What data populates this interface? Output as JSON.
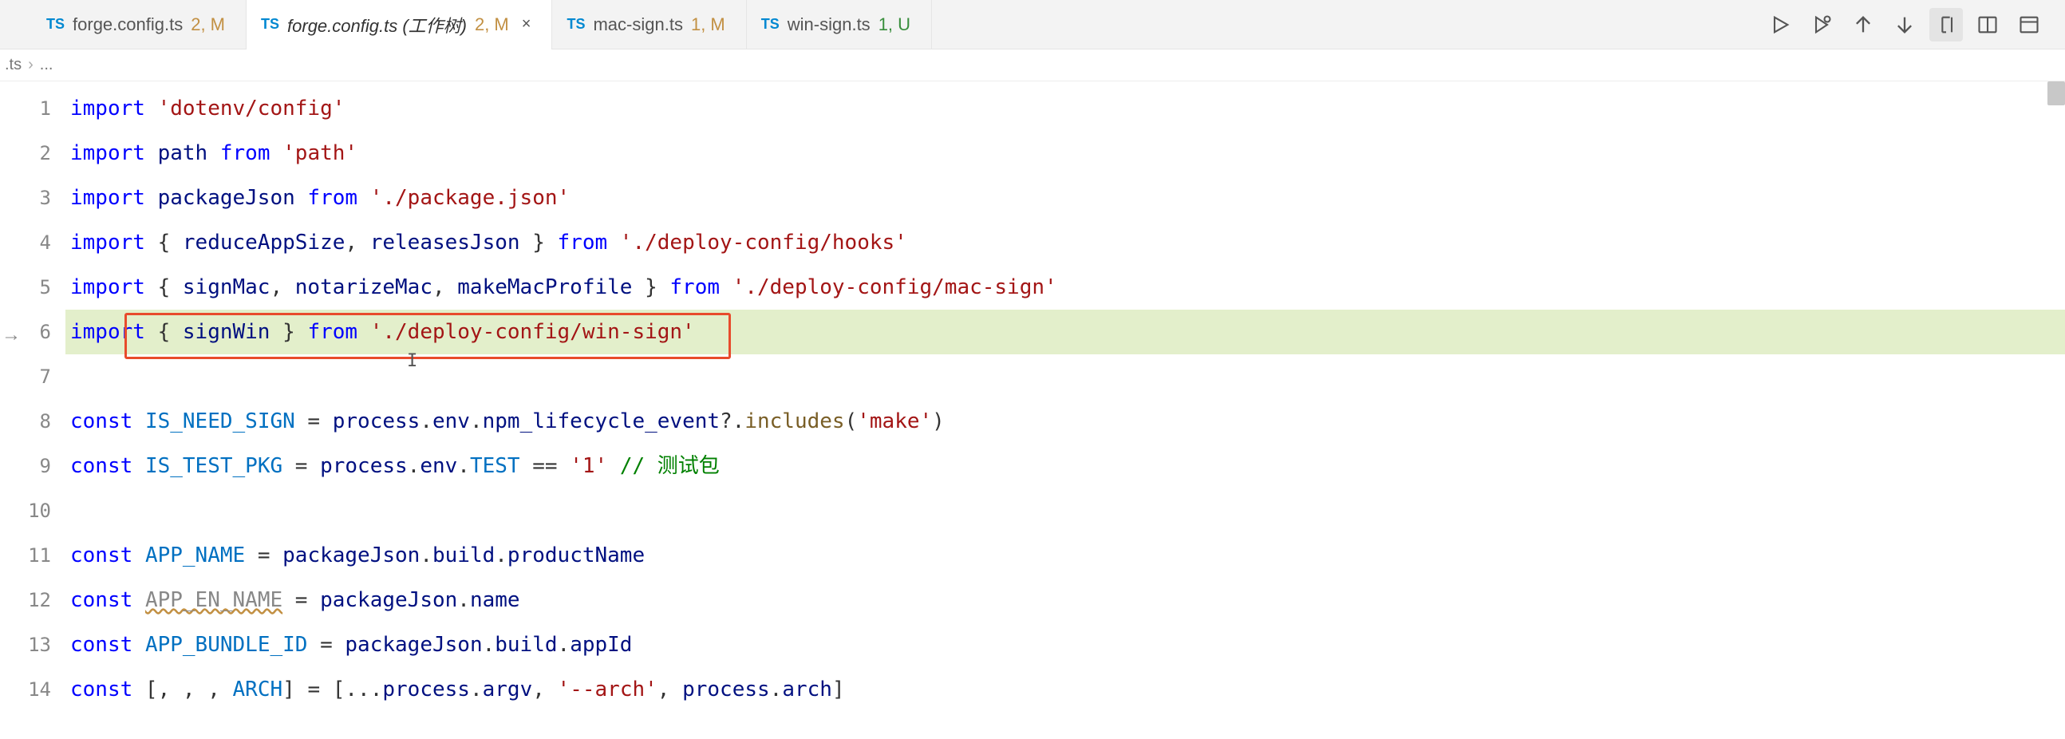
{
  "tabs": [
    {
      "icon": "TS",
      "filename": "forge.config.ts",
      "badge": "2, M",
      "badgeClass": "m",
      "active": false,
      "closable": false
    },
    {
      "icon": "TS",
      "filename": "forge.config.ts (工作树)",
      "badge": "2, M",
      "badgeClass": "m",
      "active": true,
      "closable": true
    },
    {
      "icon": "TS",
      "filename": "mac-sign.ts",
      "badge": "1, M",
      "badgeClass": "m",
      "active": false,
      "closable": false
    },
    {
      "icon": "TS",
      "filename": "win-sign.ts",
      "badge": "1, U",
      "badgeClass": "u",
      "active": false,
      "closable": false
    }
  ],
  "breadcrumb": {
    "segment0": ".ts",
    "segment1": "..."
  },
  "toolbar": {
    "run": "run",
    "debug": "debug",
    "up": "up",
    "down": "down",
    "whitespace": "whitespace",
    "split": "split",
    "more": "more"
  },
  "code": {
    "lines": [
      {
        "n": 1,
        "tokens": [
          {
            "cls": "kw",
            "t": "import"
          },
          {
            "cls": "plain",
            "t": " "
          },
          {
            "cls": "str",
            "t": "'dotenv/config'"
          }
        ]
      },
      {
        "n": 2,
        "tokens": [
          {
            "cls": "kw",
            "t": "import"
          },
          {
            "cls": "plain",
            "t": " "
          },
          {
            "cls": "ident",
            "t": "path"
          },
          {
            "cls": "plain",
            "t": " "
          },
          {
            "cls": "kw",
            "t": "from"
          },
          {
            "cls": "plain",
            "t": " "
          },
          {
            "cls": "str",
            "t": "'path'"
          }
        ]
      },
      {
        "n": 3,
        "tokens": [
          {
            "cls": "kw",
            "t": "import"
          },
          {
            "cls": "plain",
            "t": " "
          },
          {
            "cls": "ident",
            "t": "packageJson"
          },
          {
            "cls": "plain",
            "t": " "
          },
          {
            "cls": "kw",
            "t": "from"
          },
          {
            "cls": "plain",
            "t": " "
          },
          {
            "cls": "str",
            "t": "'./package.json'"
          }
        ]
      },
      {
        "n": 4,
        "tokens": [
          {
            "cls": "kw",
            "t": "import"
          },
          {
            "cls": "plain",
            "t": " { "
          },
          {
            "cls": "ident",
            "t": "reduceAppSize"
          },
          {
            "cls": "plain",
            "t": ", "
          },
          {
            "cls": "ident",
            "t": "releasesJson"
          },
          {
            "cls": "plain",
            "t": " } "
          },
          {
            "cls": "kw",
            "t": "from"
          },
          {
            "cls": "plain",
            "t": " "
          },
          {
            "cls": "str",
            "t": "'./deploy-config/hooks'"
          }
        ]
      },
      {
        "n": 5,
        "tokens": [
          {
            "cls": "kw",
            "t": "import"
          },
          {
            "cls": "plain",
            "t": " { "
          },
          {
            "cls": "ident",
            "t": "signMac"
          },
          {
            "cls": "plain",
            "t": ", "
          },
          {
            "cls": "ident",
            "t": "notarizeMac"
          },
          {
            "cls": "plain",
            "t": ", "
          },
          {
            "cls": "ident",
            "t": "makeMacProfile"
          },
          {
            "cls": "plain",
            "t": " } "
          },
          {
            "cls": "kw",
            "t": "from"
          },
          {
            "cls": "plain",
            "t": " "
          },
          {
            "cls": "str",
            "t": "'./deploy-config/mac-sign'"
          }
        ]
      },
      {
        "n": 6,
        "hl": true,
        "tokens": [
          {
            "cls": "kw",
            "t": "import"
          },
          {
            "cls": "plain",
            "t": " { "
          },
          {
            "cls": "ident",
            "t": "signWin"
          },
          {
            "cls": "plain",
            "t": " } "
          },
          {
            "cls": "kw",
            "t": "from"
          },
          {
            "cls": "plain",
            "t": " "
          },
          {
            "cls": "str",
            "t": "'./deploy-config/win-sign'"
          }
        ]
      },
      {
        "n": 7,
        "tokens": []
      },
      {
        "n": 8,
        "tokens": [
          {
            "cls": "kw",
            "t": "const"
          },
          {
            "cls": "plain",
            "t": " "
          },
          {
            "cls": "const",
            "t": "IS_NEED_SIGN"
          },
          {
            "cls": "plain",
            "t": " = "
          },
          {
            "cls": "ident",
            "t": "process"
          },
          {
            "cls": "plain",
            "t": "."
          },
          {
            "cls": "ident",
            "t": "env"
          },
          {
            "cls": "plain",
            "t": "."
          },
          {
            "cls": "ident",
            "t": "npm_lifecycle_event"
          },
          {
            "cls": "plain",
            "t": "?."
          },
          {
            "cls": "fn",
            "t": "includes"
          },
          {
            "cls": "plain",
            "t": "("
          },
          {
            "cls": "str",
            "t": "'make'"
          },
          {
            "cls": "plain",
            "t": ")"
          }
        ]
      },
      {
        "n": 9,
        "tokens": [
          {
            "cls": "kw",
            "t": "const"
          },
          {
            "cls": "plain",
            "t": " "
          },
          {
            "cls": "const",
            "t": "IS_TEST_PKG"
          },
          {
            "cls": "plain",
            "t": " = "
          },
          {
            "cls": "ident",
            "t": "process"
          },
          {
            "cls": "plain",
            "t": "."
          },
          {
            "cls": "ident",
            "t": "env"
          },
          {
            "cls": "plain",
            "t": "."
          },
          {
            "cls": "const",
            "t": "TEST"
          },
          {
            "cls": "plain",
            "t": " == "
          },
          {
            "cls": "str",
            "t": "'1'"
          },
          {
            "cls": "plain",
            "t": " "
          },
          {
            "cls": "comment",
            "t": "// 测试包"
          }
        ]
      },
      {
        "n": 10,
        "tokens": []
      },
      {
        "n": 11,
        "tokens": [
          {
            "cls": "kw",
            "t": "const"
          },
          {
            "cls": "plain",
            "t": " "
          },
          {
            "cls": "const",
            "t": "APP_NAME"
          },
          {
            "cls": "plain",
            "t": " = "
          },
          {
            "cls": "ident",
            "t": "packageJson"
          },
          {
            "cls": "plain",
            "t": "."
          },
          {
            "cls": "ident",
            "t": "build"
          },
          {
            "cls": "plain",
            "t": "."
          },
          {
            "cls": "ident",
            "t": "productName"
          }
        ]
      },
      {
        "n": 12,
        "tokens": [
          {
            "cls": "kw",
            "t": "const"
          },
          {
            "cls": "plain",
            "t": " "
          },
          {
            "cls": "squiggly",
            "t": "APP_EN_NAME"
          },
          {
            "cls": "plain",
            "t": " = "
          },
          {
            "cls": "ident",
            "t": "packageJson"
          },
          {
            "cls": "plain",
            "t": "."
          },
          {
            "cls": "ident",
            "t": "name"
          }
        ]
      },
      {
        "n": 13,
        "tokens": [
          {
            "cls": "kw",
            "t": "const"
          },
          {
            "cls": "plain",
            "t": " "
          },
          {
            "cls": "const",
            "t": "APP_BUNDLE_ID"
          },
          {
            "cls": "plain",
            "t": " = "
          },
          {
            "cls": "ident",
            "t": "packageJson"
          },
          {
            "cls": "plain",
            "t": "."
          },
          {
            "cls": "ident",
            "t": "build"
          },
          {
            "cls": "plain",
            "t": "."
          },
          {
            "cls": "ident",
            "t": "appId"
          }
        ]
      },
      {
        "n": 14,
        "tokens": [
          {
            "cls": "kw",
            "t": "const"
          },
          {
            "cls": "plain",
            "t": " [, , , "
          },
          {
            "cls": "const",
            "t": "ARCH"
          },
          {
            "cls": "plain",
            "t": "] = [..."
          },
          {
            "cls": "ident",
            "t": "process"
          },
          {
            "cls": "plain",
            "t": "."
          },
          {
            "cls": "ident",
            "t": "argv"
          },
          {
            "cls": "plain",
            "t": ", "
          },
          {
            "cls": "str",
            "t": "'--arch'"
          },
          {
            "cls": "plain",
            "t": ", "
          },
          {
            "cls": "ident",
            "t": "process"
          },
          {
            "cls": "plain",
            "t": "."
          },
          {
            "cls": "ident",
            "t": "arch"
          },
          {
            "cls": "plain",
            "t": "]"
          }
        ]
      }
    ]
  }
}
